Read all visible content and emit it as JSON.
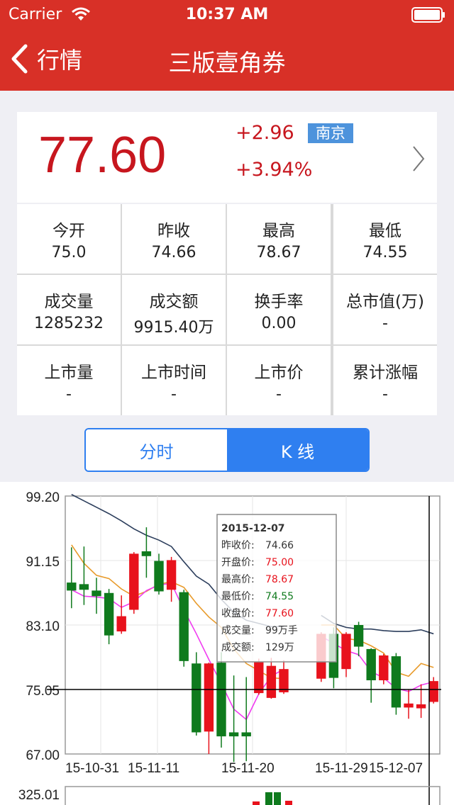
{
  "status_bar": {
    "carrier": "Carrier",
    "time": "10:37 AM"
  },
  "nav": {
    "back_label": "行情",
    "title": "三版壹角券"
  },
  "quote": {
    "price": "77.60",
    "change": "+2.96",
    "change_pct": "+3.94%",
    "region": "南京"
  },
  "stats": [
    {
      "label": "今开",
      "value": "75.0"
    },
    {
      "label": "昨收",
      "value": "74.66"
    },
    {
      "label": "最高",
      "value": "78.67"
    },
    {
      "label": "最低",
      "value": "74.55"
    },
    {
      "label": "成交量",
      "value": "1285232"
    },
    {
      "label": "成交额",
      "value": "9915.40万"
    },
    {
      "label": "换手率",
      "value": "0.00"
    },
    {
      "label": "总市值(万)",
      "value": "-"
    },
    {
      "label": "上市量",
      "value": "-"
    },
    {
      "label": "上市时间",
      "value": "-"
    },
    {
      "label": "上市价",
      "value": "-"
    },
    {
      "label": "累计涨幅",
      "value": "-"
    }
  ],
  "tabs": [
    {
      "label": "分时",
      "active": false
    },
    {
      "label": "K 线",
      "active": true
    }
  ],
  "colors": {
    "up": "#e8121c",
    "down": "#0f7a1d",
    "ma5": "#f03cf0",
    "ma10": "#e89a2a",
    "ma20": "#2c3e5c",
    "accent": "#2f7ff0",
    "header": "#d83027"
  },
  "chart_data": {
    "type": "candlestick",
    "y_axis_labels": [
      "99.20",
      "91.15",
      "83.10",
      "75.05",
      "67.00"
    ],
    "ylim": [
      67.0,
      99.2
    ],
    "x_axis_labels": [
      "15-10-31",
      "15-11-11",
      "15-11-20",
      "15-11-29",
      "15-12-07"
    ],
    "volume_top_label": "325.01",
    "crosshair_price": 75.05,
    "candles": [
      {
        "open": 88.4,
        "close": 87.4,
        "high": 92.8,
        "low": 85.2
      },
      {
        "open": 88.2,
        "close": 87.5,
        "high": 92.9,
        "low": 85.6
      },
      {
        "open": 87.4,
        "close": 86.7,
        "high": 89.0,
        "low": 84.5
      },
      {
        "open": 87.1,
        "close": 81.8,
        "high": 87.6,
        "low": 80.7
      },
      {
        "open": 82.3,
        "close": 84.2,
        "high": 86.8,
        "low": 82.0
      },
      {
        "open": 85.0,
        "close": 92.0,
        "high": 92.2,
        "low": 84.5
      },
      {
        "open": 92.3,
        "close": 91.7,
        "high": 95.3,
        "low": 89.0
      },
      {
        "open": 91.1,
        "close": 87.3,
        "high": 92.0,
        "low": 86.9
      },
      {
        "open": 87.5,
        "close": 91.2,
        "high": 91.6,
        "low": 86.0
      },
      {
        "open": 87.2,
        "close": 78.6,
        "high": 87.5,
        "low": 77.9
      },
      {
        "open": 78.3,
        "close": 69.7,
        "high": 79.7,
        "low": 69.3
      },
      {
        "open": 69.8,
        "close": 78.3,
        "high": 78.4,
        "low": 67.0
      },
      {
        "open": 78.4,
        "close": 69.2,
        "high": 79.7,
        "low": 67.8
      },
      {
        "open": 69.7,
        "close": 69.2,
        "high": 76.8,
        "low": 66.0
      },
      {
        "open": 69.7,
        "close": 69.2,
        "high": 76.6,
        "low": 66.1
      },
      {
        "open": 74.6,
        "close": 78.5,
        "high": 78.9,
        "low": 74.4
      },
      {
        "open": 74.0,
        "close": 78.0,
        "high": 79.0,
        "low": 73.9
      },
      {
        "open": 74.7,
        "close": 77.6,
        "high": 78.7,
        "low": 74.5
      }
    ],
    "candles_right": [
      {
        "open": 76.4,
        "close": 82.0,
        "high": 82.2,
        "low": 76.0
      },
      {
        "open": 82.0,
        "close": 76.5,
        "high": 82.8,
        "low": 75.2
      },
      {
        "open": 77.6,
        "close": 82.0,
        "high": 82.2,
        "low": 76.6
      },
      {
        "open": 83.1,
        "close": 80.4,
        "high": 83.5,
        "low": 79.2
      },
      {
        "open": 80.1,
        "close": 76.2,
        "high": 80.2,
        "low": 73.4
      },
      {
        "open": 76.2,
        "close": 79.3,
        "high": 79.5,
        "low": 75.7
      },
      {
        "open": 79.2,
        "close": 72.8,
        "high": 79.6,
        "low": 71.9
      },
      {
        "open": 72.8,
        "close": 73.3,
        "high": 75.0,
        "low": 71.4
      },
      {
        "open": 72.7,
        "close": 73.2,
        "high": 75.7,
        "low": 71.5
      },
      {
        "open": 73.5,
        "close": 76.1,
        "high": 76.6,
        "low": 73.3
      }
    ],
    "ma5_right": [
      81.7,
      80.8,
      79.9,
      79.4,
      77.3,
      76.5,
      75.2,
      74.8,
      75.6,
      76.0
    ],
    "ma10_right": [
      83.1,
      83.1,
      81.4,
      81.2,
      80.5,
      79.6,
      77.2,
      76.7,
      78.3,
      77.8
    ],
    "ma20_right": [
      84.3,
      83.3,
      82.8,
      82.6,
      82.6,
      82.4,
      82.3,
      82.3,
      82.5,
      82.0
    ],
    "ma5": [
      87.5,
      86.7,
      86.6,
      86.4,
      85.3,
      86.0,
      87.4,
      88.1,
      88.3,
      85.0,
      82.0,
      78.8,
      75.8,
      72.6,
      71.3,
      74.5,
      76.7,
      77.6
    ],
    "ma10": [
      93.1,
      90.8,
      89.3,
      88.9,
      87.6,
      86.7,
      87.3,
      88.2,
      88.5,
      87.8,
      85.8,
      84.1,
      82.8,
      80.1,
      78.3,
      77.4,
      76.5,
      76.4
    ],
    "ma20": [
      99.4,
      98.6,
      97.8,
      97.0,
      96.1,
      95.1,
      94.3,
      93.7,
      92.9,
      91.0,
      89.2,
      88.2,
      86.3,
      84.7,
      83.7,
      83.3,
      82.9,
      82.9
    ],
    "tooltip": {
      "date": "2015-12-07",
      "rows": [
        {
          "label": "昨收价:",
          "value": "74.66",
          "color": "#333333"
        },
        {
          "label": "开盘价:",
          "value": "75.00",
          "color": "#e8121c"
        },
        {
          "label": "最高价:",
          "value": "78.67",
          "color": "#e8121c"
        },
        {
          "label": "最低价:",
          "value": "74.55",
          "color": "#0f7a1d"
        },
        {
          "label": "收盘价:",
          "value": "77.60",
          "color": "#e8121c"
        },
        {
          "label": "成交量:",
          "value": "99万手",
          "color": "#333333"
        },
        {
          "label": "成交额:",
          "value": "129万",
          "color": "#333333"
        }
      ]
    }
  }
}
